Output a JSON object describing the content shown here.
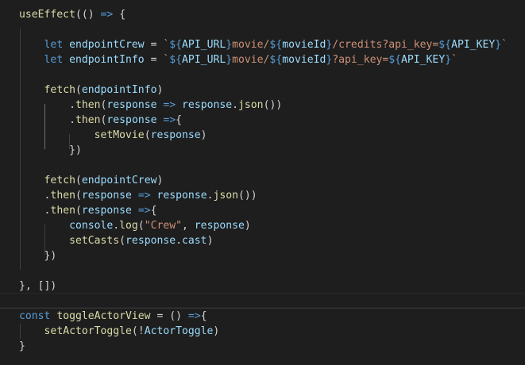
{
  "editor": {
    "theme": "dark",
    "background": "#1e1e1e",
    "lines": [
      [
        [
          "useEffect",
          "fn"
        ],
        [
          "(",
          "punc"
        ],
        [
          "(",
          "punc"
        ],
        [
          ")",
          "punc"
        ],
        [
          " ",
          "punc"
        ],
        [
          "=>",
          "kw"
        ],
        [
          " ",
          "punc"
        ],
        [
          "{",
          "punc"
        ]
      ],
      [],
      [
        [
          "    ",
          "punc"
        ],
        [
          "let",
          "kw"
        ],
        [
          " ",
          "punc"
        ],
        [
          "endpointCrew",
          "var"
        ],
        [
          " = ",
          "punc"
        ],
        [
          "`",
          "str"
        ],
        [
          "${",
          "tpl"
        ],
        [
          "API_URL",
          "var"
        ],
        [
          "}",
          "tpl"
        ],
        [
          "movie/",
          "str"
        ],
        [
          "${",
          "tpl"
        ],
        [
          "movieId",
          "var"
        ],
        [
          "}",
          "tpl"
        ],
        [
          "/credits?api_key=",
          "str"
        ],
        [
          "${",
          "tpl"
        ],
        [
          "API_KEY",
          "var"
        ],
        [
          "}",
          "tpl"
        ],
        [
          "`",
          "str"
        ]
      ],
      [
        [
          "    ",
          "punc"
        ],
        [
          "let",
          "kw"
        ],
        [
          " ",
          "punc"
        ],
        [
          "endpointInfo",
          "var"
        ],
        [
          " = ",
          "punc"
        ],
        [
          "`",
          "str"
        ],
        [
          "${",
          "tpl"
        ],
        [
          "API_URL",
          "var"
        ],
        [
          "}",
          "tpl"
        ],
        [
          "movie/",
          "str"
        ],
        [
          "${",
          "tpl"
        ],
        [
          "movieId",
          "var"
        ],
        [
          "}",
          "tpl"
        ],
        [
          "?api_key=",
          "str"
        ],
        [
          "${",
          "tpl"
        ],
        [
          "API_KEY",
          "var"
        ],
        [
          "}",
          "tpl"
        ],
        [
          "`",
          "str"
        ]
      ],
      [],
      [
        [
          "    ",
          "punc"
        ],
        [
          "fetch",
          "fn"
        ],
        [
          "(",
          "punc"
        ],
        [
          "endpointInfo",
          "var"
        ],
        [
          ")",
          "punc"
        ]
      ],
      [
        [
          "        ",
          "punc"
        ],
        [
          ".",
          "punc"
        ],
        [
          "then",
          "fn"
        ],
        [
          "(",
          "punc"
        ],
        [
          "response",
          "var"
        ],
        [
          " ",
          "punc"
        ],
        [
          "=>",
          "kw"
        ],
        [
          " ",
          "punc"
        ],
        [
          "response",
          "var"
        ],
        [
          ".",
          "punc"
        ],
        [
          "json",
          "fn"
        ],
        [
          "())",
          "punc"
        ]
      ],
      [
        [
          "        ",
          "punc"
        ],
        [
          ".",
          "punc"
        ],
        [
          "then",
          "fn"
        ],
        [
          "(",
          "punc"
        ],
        [
          "response",
          "var"
        ],
        [
          " ",
          "punc"
        ],
        [
          "=>",
          "kw"
        ],
        [
          "{",
          "punc"
        ]
      ],
      [
        [
          "            ",
          "punc"
        ],
        [
          "setMovie",
          "fn"
        ],
        [
          "(",
          "punc"
        ],
        [
          "response",
          "var"
        ],
        [
          ")",
          "punc"
        ]
      ],
      [
        [
          "        ",
          "punc"
        ],
        [
          "})",
          "punc"
        ]
      ],
      [],
      [
        [
          "    ",
          "punc"
        ],
        [
          "fetch",
          "fn"
        ],
        [
          "(",
          "punc"
        ],
        [
          "endpointCrew",
          "var"
        ],
        [
          ")",
          "punc"
        ]
      ],
      [
        [
          "    ",
          "punc"
        ],
        [
          ".",
          "punc"
        ],
        [
          "then",
          "fn"
        ],
        [
          "(",
          "punc"
        ],
        [
          "response",
          "var"
        ],
        [
          " ",
          "punc"
        ],
        [
          "=>",
          "kw"
        ],
        [
          " ",
          "punc"
        ],
        [
          "response",
          "var"
        ],
        [
          ".",
          "punc"
        ],
        [
          "json",
          "fn"
        ],
        [
          "())",
          "punc"
        ]
      ],
      [
        [
          "    ",
          "punc"
        ],
        [
          ".",
          "punc"
        ],
        [
          "then",
          "fn"
        ],
        [
          "(",
          "punc"
        ],
        [
          "response",
          "var"
        ],
        [
          " ",
          "punc"
        ],
        [
          "=>",
          "kw"
        ],
        [
          "{",
          "punc"
        ]
      ],
      [
        [
          "        ",
          "punc"
        ],
        [
          "console",
          "var"
        ],
        [
          ".",
          "punc"
        ],
        [
          "log",
          "fn"
        ],
        [
          "(",
          "punc"
        ],
        [
          "\"Crew\"",
          "str"
        ],
        [
          ", ",
          "punc"
        ],
        [
          "response",
          "var"
        ],
        [
          ")",
          "punc"
        ]
      ],
      [
        [
          "        ",
          "punc"
        ],
        [
          "setCasts",
          "fn"
        ],
        [
          "(",
          "punc"
        ],
        [
          "response",
          "var"
        ],
        [
          ".",
          "punc"
        ],
        [
          "cast",
          "var"
        ],
        [
          ")",
          "punc"
        ]
      ],
      [
        [
          "    ",
          "punc"
        ],
        [
          "})",
          "punc"
        ]
      ],
      [],
      [
        [
          "}, [])",
          "punc"
        ]
      ],
      [],
      [
        [
          "const",
          "kw"
        ],
        [
          " ",
          "punc"
        ],
        [
          "toggleActorView",
          "fn"
        ],
        [
          " = ",
          "punc"
        ],
        [
          "()",
          "punc"
        ],
        [
          " ",
          "punc"
        ],
        [
          "=>",
          "kw"
        ],
        [
          "{",
          "punc"
        ]
      ],
      [
        [
          "    ",
          "punc"
        ],
        [
          "setActorToggle",
          "fn"
        ],
        [
          "(",
          "punc"
        ],
        [
          "!",
          "punc"
        ],
        [
          "ActorToggle",
          "var"
        ],
        [
          ")",
          "punc"
        ]
      ],
      [
        [
          "}",
          "punc"
        ]
      ]
    ]
  }
}
